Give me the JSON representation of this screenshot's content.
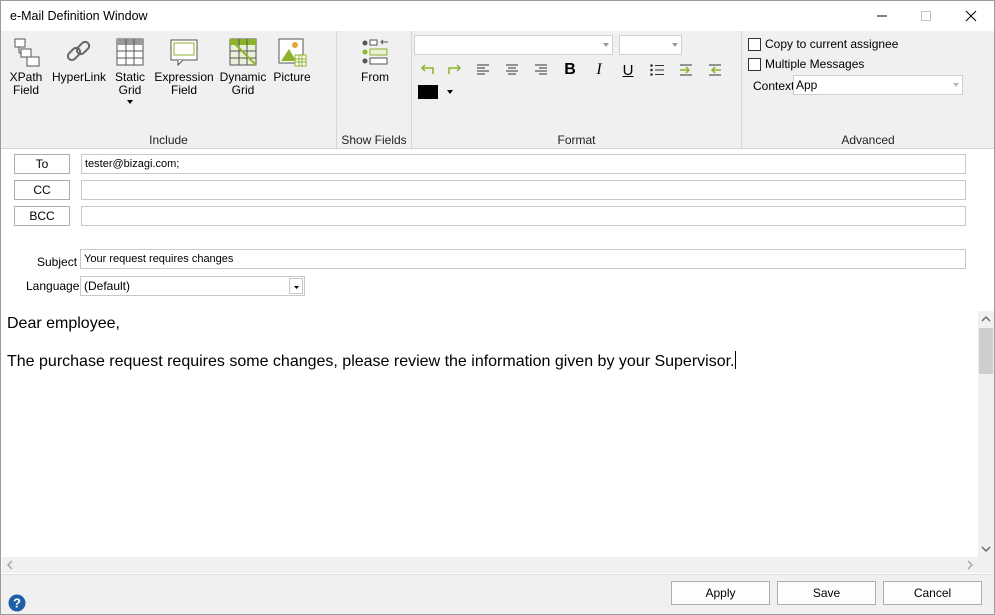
{
  "window": {
    "title": "e-Mail Definition Window"
  },
  "ribbon": {
    "include": {
      "label": "Include",
      "buttons": [
        {
          "name": "xpath-field",
          "label": "XPath\nField"
        },
        {
          "name": "hyperlink",
          "label": "HyperLink"
        },
        {
          "name": "static-grid",
          "label": "Static\nGrid"
        },
        {
          "name": "expression-field",
          "label": "Expression\nField"
        },
        {
          "name": "dynamic-grid",
          "label": "Dynamic\nGrid"
        },
        {
          "name": "picture",
          "label": "Picture"
        }
      ]
    },
    "show_fields": {
      "label": "Show Fields",
      "from_label": "From"
    },
    "format": {
      "label": "Format",
      "font_value": "",
      "size_value": "",
      "color": "#000000"
    },
    "advanced": {
      "label": "Advanced",
      "copy_label": "Copy to current assignee",
      "multiple_label": "Multiple Messages",
      "context_label": "Context",
      "context_value": "App"
    }
  },
  "form": {
    "to_label": "To",
    "to_value": "tester@bizagi.com;",
    "cc_label": "CC",
    "cc_value": "",
    "bcc_label": "BCC",
    "bcc_value": "",
    "subject_label": "Subject",
    "subject_value": "Your request requires changes",
    "language_label": "Language:",
    "language_value": "(Default)"
  },
  "body": {
    "line1": "Dear employee,",
    "line2": "The purchase request requires some changes, please review the information given by your Supervisor."
  },
  "footer": {
    "apply_label": "Apply",
    "save_label": "Save",
    "cancel_label": "Cancel"
  },
  "colors": {
    "accent_green": "#8db32a",
    "help_blue": "#1f5fa8"
  }
}
